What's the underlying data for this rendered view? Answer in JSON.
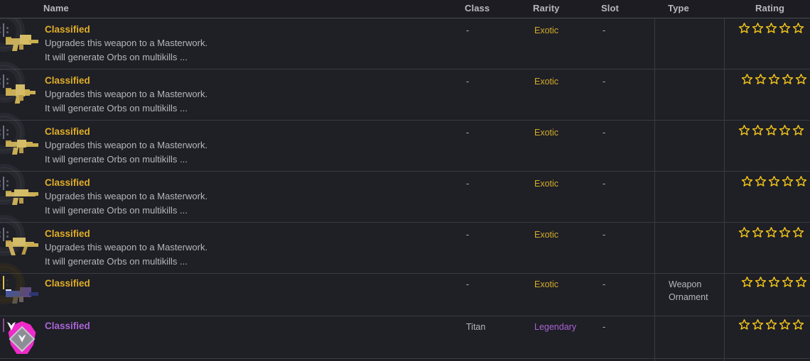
{
  "header": {
    "columns": [
      {
        "key": "name",
        "label": "Name"
      },
      {
        "key": "class",
        "label": "Class"
      },
      {
        "key": "rarity",
        "label": "Rarity"
      },
      {
        "key": "slot",
        "label": "Slot"
      },
      {
        "key": "type",
        "label": "Type"
      },
      {
        "key": "rating",
        "label": "Rating"
      }
    ]
  },
  "colors": {
    "background": "#1c1c22",
    "row_background": "#1f1f26",
    "row_divider": "#3a3a42",
    "header_divider": "#4a4a52",
    "header_text": "#b8b8bd",
    "body_text": "#b6b6bb",
    "exotic": "#d3ac29",
    "exotic_title": "#e0ae26",
    "legendary": "#a964d4",
    "star": "#f0c419"
  },
  "rows": [
    {
      "icon": "weapon-icon-gold",
      "name": "Classified",
      "name_rarity": "exotic",
      "description_line_1": "Upgrades this weapon to a Masterwork.",
      "description_line_2": "It will generate Orbs on multikills ...",
      "class": "-",
      "rarity": "Exotic",
      "rarity_tier": "exotic",
      "slot": "-",
      "type": "",
      "rating_stars_total": 5,
      "rating_stars_filled": 0
    },
    {
      "icon": "weapon-icon-gold",
      "name": "Classified",
      "name_rarity": "exotic",
      "description_line_1": "Upgrades this weapon to a Masterwork.",
      "description_line_2": "It will generate Orbs on multikills ...",
      "class": "-",
      "rarity": "Exotic",
      "rarity_tier": "exotic",
      "slot": "-",
      "type": "",
      "rating_stars_total": 5,
      "rating_stars_filled": 0
    },
    {
      "icon": "weapon-icon-gold",
      "name": "Classified",
      "name_rarity": "exotic",
      "description_line_1": "Upgrades this weapon to a Masterwork.",
      "description_line_2": "It will generate Orbs on multikills ...",
      "class": "-",
      "rarity": "Exotic",
      "rarity_tier": "exotic",
      "slot": "-",
      "type": "",
      "rating_stars_total": 5,
      "rating_stars_filled": 0
    },
    {
      "icon": "weapon-icon-gold",
      "name": "Classified",
      "name_rarity": "exotic",
      "description_line_1": "Upgrades this weapon to a Masterwork.",
      "description_line_2": "It will generate Orbs on multikills ...",
      "class": "-",
      "rarity": "Exotic",
      "rarity_tier": "exotic",
      "slot": "-",
      "type": "",
      "rating_stars_total": 5,
      "rating_stars_filled": 0
    },
    {
      "icon": "weapon-icon-gold",
      "name": "Classified",
      "name_rarity": "exotic",
      "description_line_1": "Upgrades this weapon to a Masterwork.",
      "description_line_2": "It will generate Orbs on multikills ...",
      "class": "-",
      "rarity": "Exotic",
      "rarity_tier": "exotic",
      "slot": "-",
      "type": "",
      "rating_stars_total": 5,
      "rating_stars_filled": 0
    },
    {
      "icon": "weapon-ornament-icon",
      "name": "Classified",
      "name_rarity": "exotic",
      "description_line_1": "",
      "description_line_2": "",
      "class": "-",
      "rarity": "Exotic",
      "rarity_tier": "exotic",
      "slot": "-",
      "type": "Weapon Ornament",
      "rating_stars_total": 5,
      "rating_stars_filled": 0
    },
    {
      "icon": "armor-icon-legendary",
      "name": "Classified",
      "name_rarity": "legendary",
      "description_line_1": "",
      "description_line_2": "",
      "class": "Titan",
      "rarity": "Legendary",
      "rarity_tier": "legendary",
      "slot": "-",
      "type": "",
      "rating_stars_total": 5,
      "rating_stars_filled": 0
    }
  ]
}
